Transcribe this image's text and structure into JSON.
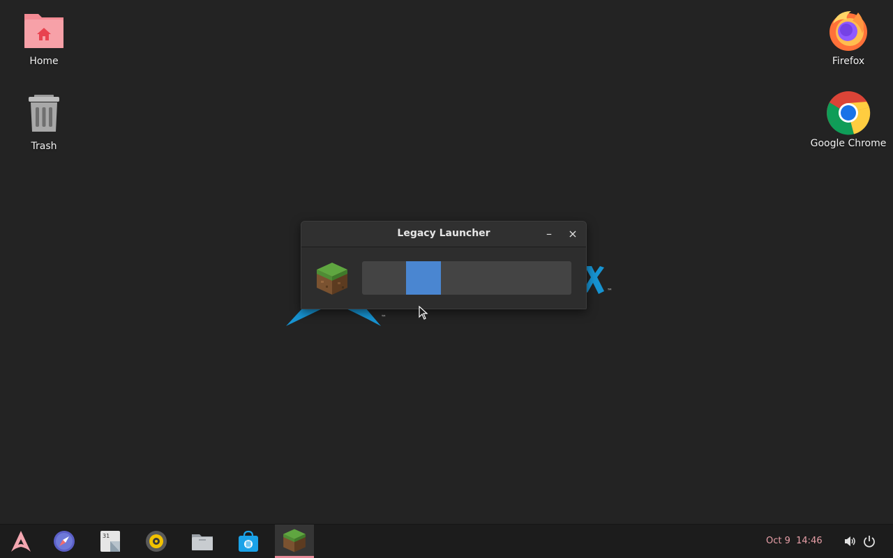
{
  "desktop": {
    "icons": [
      {
        "label": "Home",
        "icon": "home-folder-icon"
      },
      {
        "label": "Trash",
        "icon": "trash-icon"
      },
      {
        "label": "Firefox",
        "icon": "firefox-icon"
      },
      {
        "label": "Google Chrome",
        "icon": "chrome-icon"
      }
    ]
  },
  "window": {
    "title": "Legacy Launcher",
    "minimize_label": "–",
    "close_label": "×",
    "progress": {
      "state": "indeterminate",
      "indicator_color": "#4a86d1"
    }
  },
  "taskbar": {
    "apps": [
      {
        "name": "arch-menu-icon"
      },
      {
        "name": "web-browser-icon"
      },
      {
        "name": "calendar-icon"
      },
      {
        "name": "music-player-icon"
      },
      {
        "name": "files-icon"
      },
      {
        "name": "software-store-icon"
      },
      {
        "name": "legacy-launcher-icon",
        "active": true
      }
    ],
    "clock": "Oct 9  14:46",
    "tray": [
      "volume-icon",
      "power-icon"
    ]
  },
  "colors": {
    "desktop_bg": "#232323",
    "accent": "#e58a98",
    "progress_fill": "#4a86d1",
    "arch_blue": "#1793d1"
  }
}
